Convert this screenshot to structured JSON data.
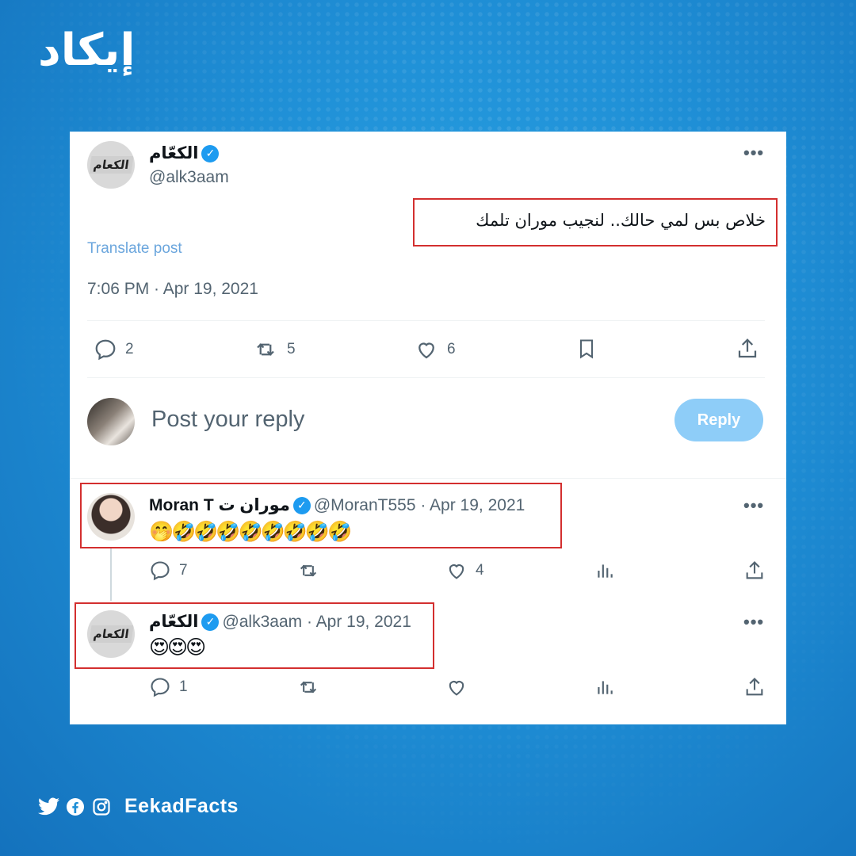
{
  "brand": {
    "logo_text": "إيكاد",
    "footer_handle": "EekadFacts"
  },
  "main_tweet": {
    "display_name": "الكعّام",
    "handle": "@alk3aam",
    "avatar_label": "الكعام",
    "text": "خلاص بس لمي حالك.. لنجيب موران تلمك",
    "translate_label": "Translate post",
    "timestamp": "7:06 PM · Apr 19, 2021",
    "replies": "2",
    "retweets": "5",
    "likes": "6"
  },
  "reply_box": {
    "placeholder": "Post your reply",
    "button_label": "Reply"
  },
  "reply1": {
    "display_name": "Moran T موران ت",
    "handle_date": "@MoranT555 · Apr 19, 2021",
    "text": "🤭🤣🤣🤣🤣🤣🤣🤣🤣",
    "replies": "7",
    "likes": "4"
  },
  "reply2": {
    "display_name": "الكعّام",
    "handle_date": "@alk3aam · Apr 19, 2021",
    "avatar_label": "الكعام",
    "text": "😍😍😍",
    "replies": "1"
  },
  "colors": {
    "highlight": "#d32f2f",
    "verified": "#1d9bf0",
    "reply_button": "#8ecdf8"
  },
  "icons": [
    "verified-badge-icon",
    "more-icon",
    "reply-icon",
    "retweet-icon",
    "like-icon",
    "bookmark-icon",
    "share-icon",
    "views-icon",
    "twitter-icon",
    "facebook-icon",
    "instagram-icon"
  ]
}
